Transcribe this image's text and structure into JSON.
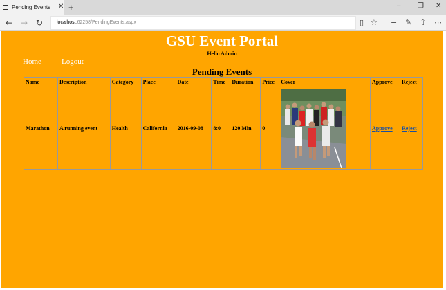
{
  "browser": {
    "tab_title": "Pending Events",
    "url_host": "localhost",
    "url_path": ":62258/PendingEvents.aspx"
  },
  "page": {
    "portal_title": "GSU Event Portal",
    "greeting": "Hello Admin",
    "nav": {
      "home": "Home",
      "logout": "Logout"
    },
    "section_title": "Pending Events"
  },
  "table": {
    "headers": [
      "Name",
      "Description",
      "Category",
      "Place",
      "Date",
      "Time",
      "Duration",
      "Price",
      "Cover",
      "Approve",
      "Reject"
    ],
    "rows": [
      {
        "name": "Marathon",
        "description": "A running event",
        "category": "Health",
        "place": "California",
        "date": "2016-09-08",
        "time": "8:0",
        "duration": "120 Min",
        "price": "0",
        "approve": "Approve",
        "reject": "Reject"
      }
    ]
  },
  "colors": {
    "page_bg": "#ffa500",
    "link": "#1a4fa0"
  }
}
